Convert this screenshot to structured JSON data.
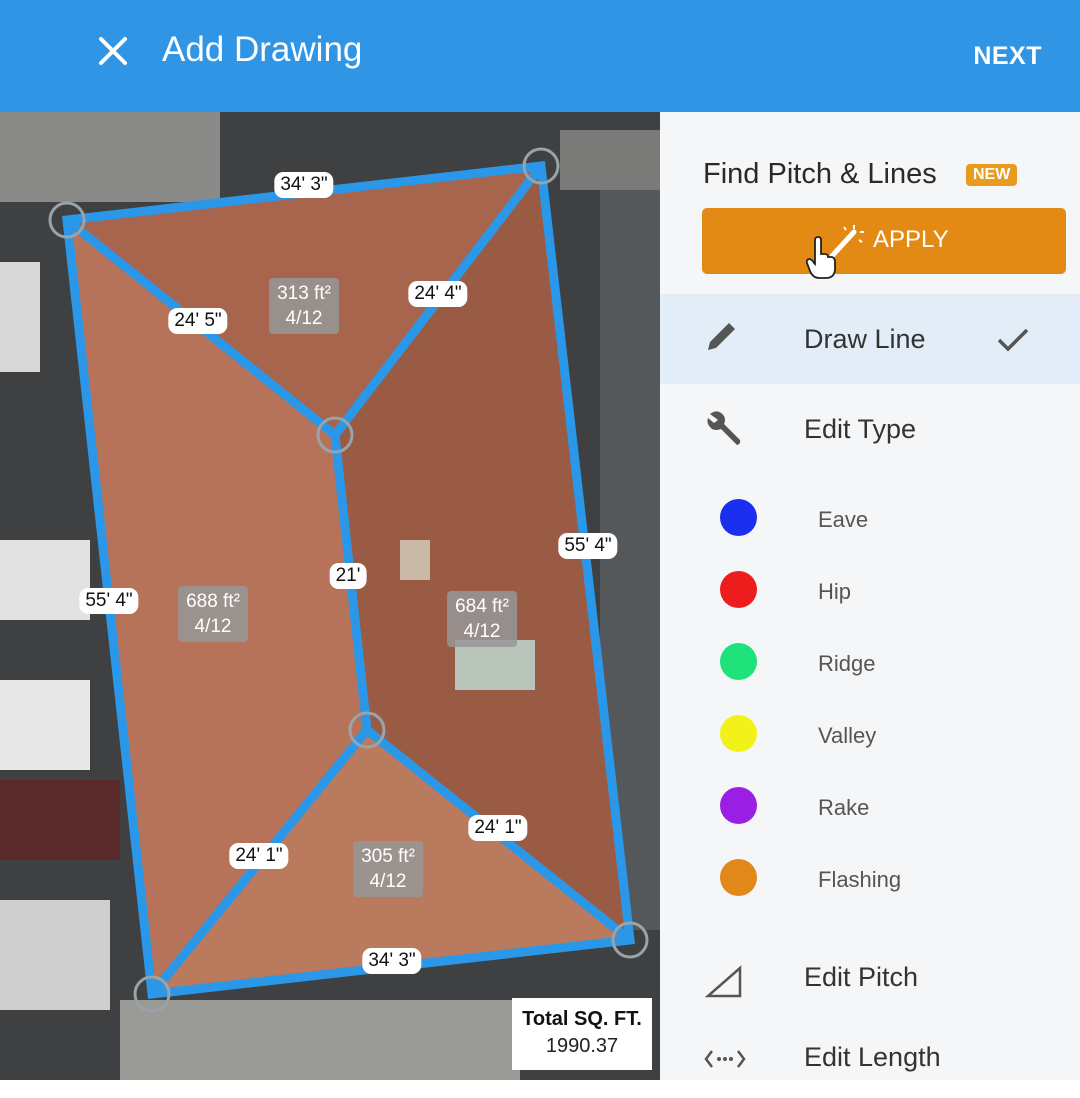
{
  "header": {
    "title": "Add Drawing",
    "next_label": "NEXT",
    "close_icon": "close-icon"
  },
  "panel": {
    "find_title": "Find Pitch & Lines",
    "new_badge": "NEW",
    "apply_label": "APPLY",
    "draw_line": "Draw Line",
    "edit_type": "Edit Type",
    "types": [
      {
        "label": "Eave",
        "color": "#1a2ff0"
      },
      {
        "label": "Hip",
        "color": "#ee1d1d"
      },
      {
        "label": "Ridge",
        "color": "#1fe27a"
      },
      {
        "label": "Valley",
        "color": "#f2f21a"
      },
      {
        "label": "Rake",
        "color": "#9b1fe2"
      },
      {
        "label": "Flashing",
        "color": "#e2871a"
      }
    ],
    "edit_pitch": "Edit Pitch",
    "edit_length": "Edit Length"
  },
  "map": {
    "measurements": [
      "34' 3\"",
      "24' 5\"",
      "24' 4\"",
      "21'",
      "55' 4\"",
      "55' 4\"",
      "24' 1\"",
      "24' 1\"",
      "34' 3\""
    ],
    "areas": [
      {
        "size": "313 ft²",
        "pitch": "4/12"
      },
      {
        "size": "688 ft²",
        "pitch": "4/12"
      },
      {
        "size": "684 ft²",
        "pitch": "4/12"
      },
      {
        "size": "305 ft²",
        "pitch": "4/12"
      }
    ],
    "total_label": "Total SQ. FT.",
    "total_value": "1990.37"
  },
  "colors": {
    "header": "#2f95e4",
    "line": "#2b97e8",
    "apply": "#e28a14",
    "roof": "#b7735a"
  }
}
